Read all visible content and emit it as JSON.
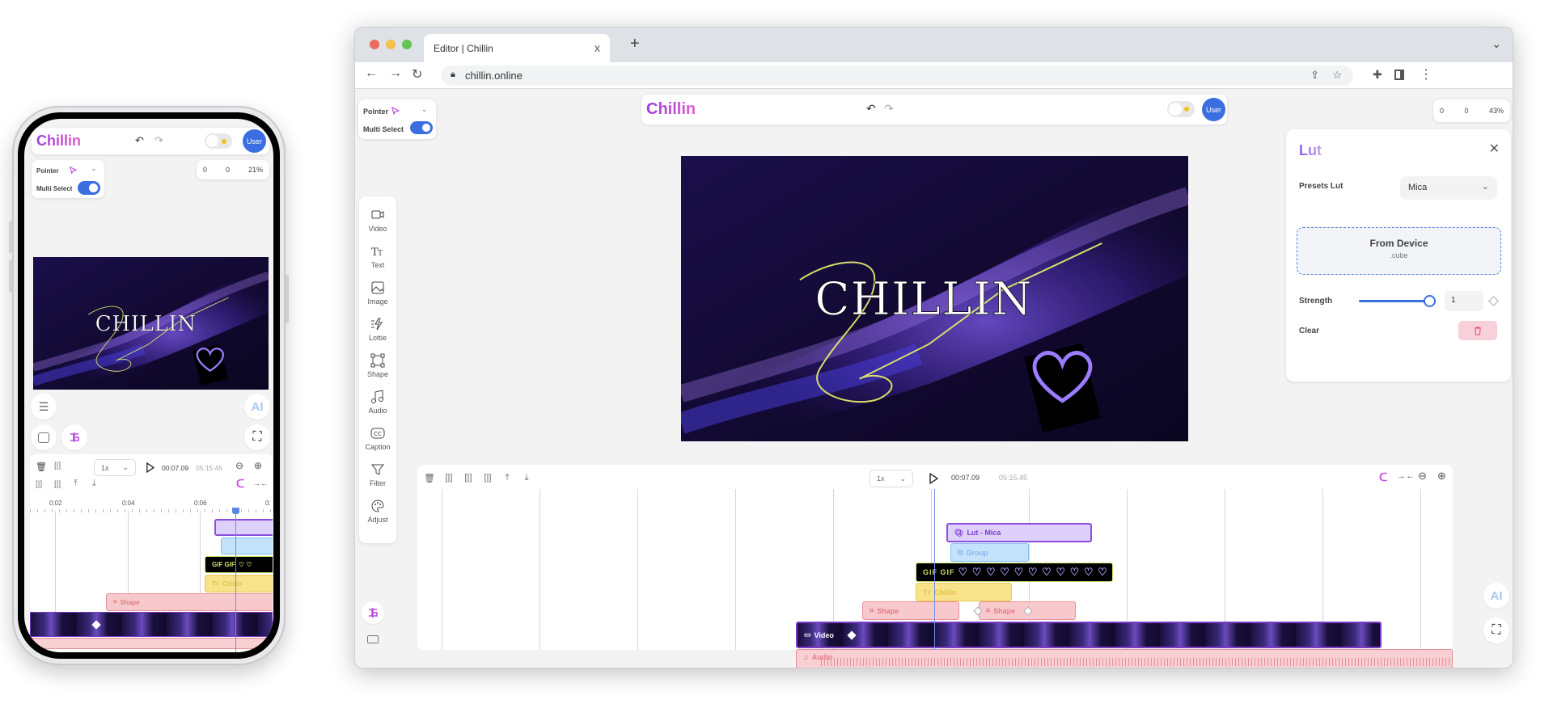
{
  "browser": {
    "tab_title": "Editor | Chillin",
    "tab_close": "x",
    "new_tab": "+",
    "tab_menu": "⌄",
    "url": "chillin.online",
    "traffic_colors": [
      "#ed6a5e",
      "#f5bf4f",
      "#61c554"
    ]
  },
  "app": {
    "logo": "Chillin",
    "user_label": "User",
    "pointer_label": "Pointer",
    "multi_select_label": "Multi Select",
    "multi_select_on": true,
    "coords": {
      "x": "0",
      "y": "0",
      "zoom": "43%"
    },
    "canvas_title": "CHILLIN",
    "accent": "#3b6ee0",
    "brand": "#9b3fd6"
  },
  "toolbar": {
    "items": [
      {
        "label": "Video",
        "icon": "video-icon"
      },
      {
        "label": "Text",
        "icon": "text-icon"
      },
      {
        "label": "Image",
        "icon": "image-icon"
      },
      {
        "label": "Lottie",
        "icon": "lottie-icon"
      },
      {
        "label": "Shape",
        "icon": "shape-icon"
      },
      {
        "label": "Audio",
        "icon": "audio-icon"
      },
      {
        "label": "Caption",
        "icon": "caption-icon"
      },
      {
        "label": "Filter",
        "icon": "filter-icon"
      },
      {
        "label": "Adjust",
        "icon": "adjust-icon"
      }
    ]
  },
  "lut_panel": {
    "title": "Lut",
    "presets_label": "Presets Lut",
    "preset_value": "Mica",
    "upload_title": "From Device",
    "upload_ext": ".cube",
    "strength_label": "Strength",
    "strength_value": "1",
    "strength_fraction": 1,
    "clear_label": "Clear"
  },
  "timeline": {
    "speed": "1x",
    "current_time": "00:07.09",
    "total_time": "05:15.45",
    "clips": {
      "lut": "Lut - Mica",
      "group": "Group",
      "gif": "GIF GIF",
      "text": "Chillin",
      "shape1": "Shape",
      "shape2": "Shape",
      "video": "Video",
      "audio": "Audio"
    }
  },
  "ai_label": "AI",
  "mobile": {
    "coords": {
      "x": "0",
      "y": "0",
      "zoom": "21%"
    },
    "ruler": [
      "0:02",
      "0:04",
      "0:06",
      "0:"
    ],
    "clips": {
      "gif": "GIF GIF",
      "text": "Chillin",
      "shape": "Shape"
    }
  }
}
